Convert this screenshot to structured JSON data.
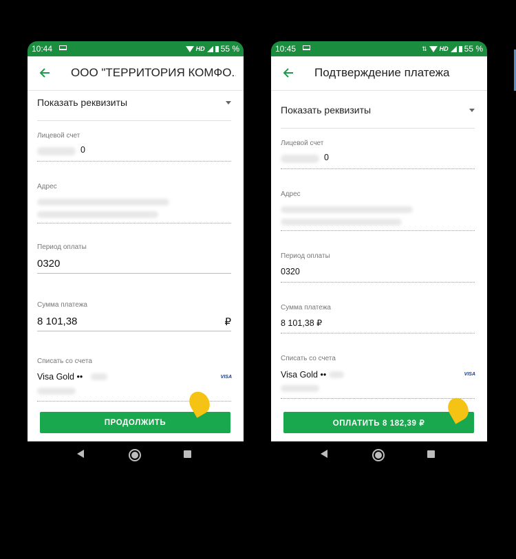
{
  "left": {
    "status": {
      "time": "10:44",
      "network": "HD",
      "battery": "55 %"
    },
    "title": "ООО \"ТЕРРИТОРИЯ КОМФО...",
    "show_details": "Показать реквизиты",
    "account_label": "Лицевой счет",
    "account_value": "0",
    "address_label": "Адрес",
    "period_label": "Период оплаты",
    "period_value": "0320",
    "amount_label": "Сумма платежа",
    "amount_value": "8 101,38",
    "currency": "₽",
    "debit_label": "Списать со счета",
    "card_name": "Visa Gold ••",
    "card_brand": "VISA",
    "button_label": "ПРОДОЛЖИТЬ"
  },
  "right": {
    "status": {
      "time": "10:45",
      "network": "HD",
      "battery": "55 %"
    },
    "title": "Подтверждение платежа",
    "show_details": "Показать реквизиты",
    "account_label": "Лицевой счет",
    "account_value": "0",
    "address_label": "Адрес",
    "period_label": "Период оплаты",
    "period_value": "0320",
    "amount_label": "Сумма платежа",
    "amount_value": "8 101,38 ₽",
    "debit_label": "Списать со счета",
    "card_name": "Visa Gold ••",
    "card_brand": "VISA",
    "button_label": "ОПЛАТИТЬ 8 182,39 ₽"
  },
  "colors": {
    "statusbar": "#1b8d3f",
    "accent": "#1aa84e",
    "marker": "#f4c314",
    "background": "#000000"
  }
}
